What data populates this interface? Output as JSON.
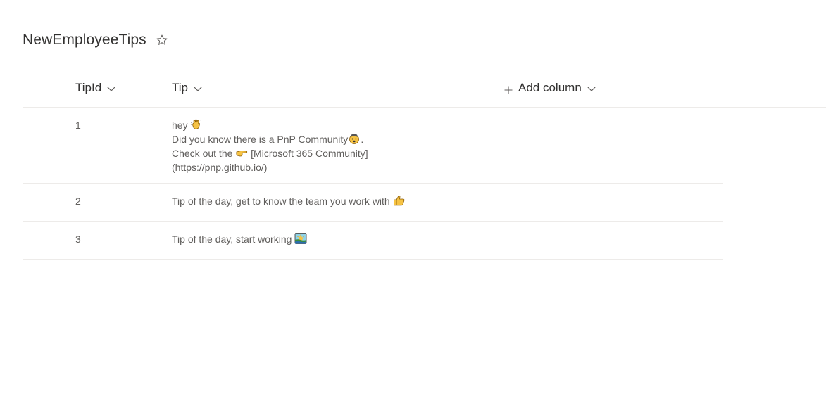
{
  "list": {
    "title": "NewEmployeeTips",
    "favorite_icon": "star-outline-icon"
  },
  "columns": {
    "tipid": "TipId",
    "tip": "Tip",
    "add_column": "Add column"
  },
  "rows": [
    {
      "id": "1",
      "lines": [
        {
          "text": "hey ",
          "emoji": "waving-hand-icon"
        },
        {
          "text": "Did you know there is a PnP Community",
          "emoji": "mind-blown-icon",
          "suffix": "."
        },
        {
          "text": "Check out the ",
          "emoji": "pointing-right-icon",
          "suffix": " [Microsoft 365 Community]"
        },
        {
          "text": "(https://pnp.github.io/)"
        }
      ]
    },
    {
      "id": "2",
      "lines": [
        {
          "text": "Tip of the day, get to know the team you work with ",
          "emoji": "thumbs-up-icon"
        }
      ]
    },
    {
      "id": "3",
      "lines": [
        {
          "text": "Tip of the day, start working ",
          "emoji": "sunrise-icon"
        }
      ]
    }
  ]
}
